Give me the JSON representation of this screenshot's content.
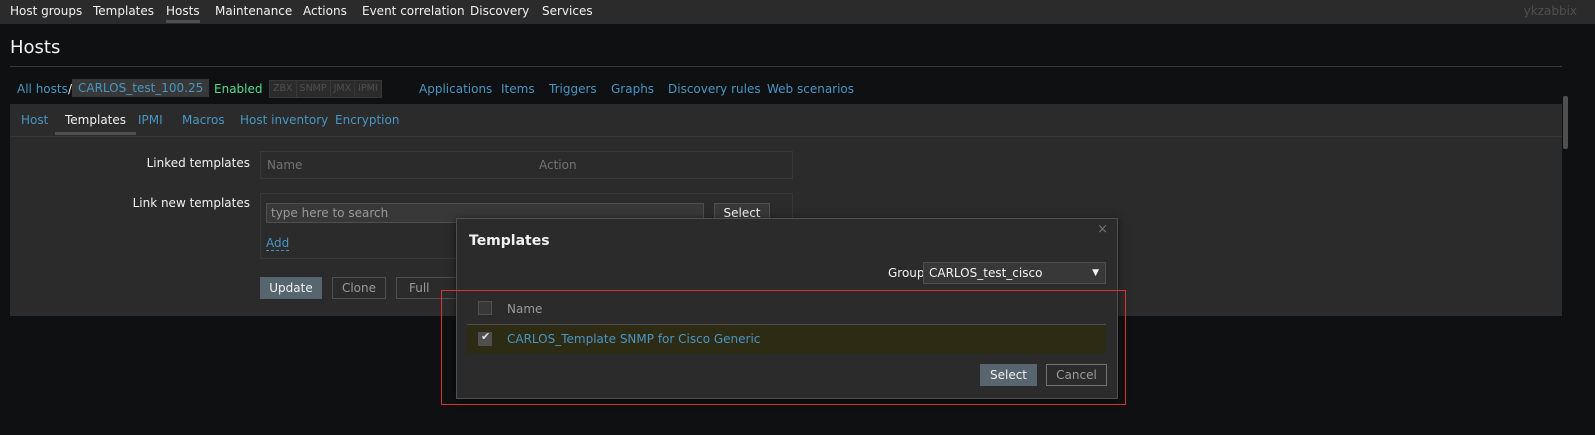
{
  "topnav": {
    "items": [
      "Host groups",
      "Templates",
      "Hosts",
      "Maintenance",
      "Actions",
      "Event correlation",
      "Discovery",
      "Services"
    ],
    "active": "Hosts",
    "user": "ykzabbix"
  },
  "page": {
    "title": "Hosts"
  },
  "host_nav": {
    "all_hosts": "All hosts",
    "separator": "/",
    "host_name": "CARLOS_test_100.25",
    "status": "Enabled",
    "availability": [
      "ZBX",
      "SNMP",
      "JMX",
      "IPMI"
    ],
    "links": [
      "Applications",
      "Items",
      "Triggers",
      "Graphs",
      "Discovery rules",
      "Web scenarios"
    ]
  },
  "tabs": [
    "Host",
    "Templates",
    "IPMI",
    "Macros",
    "Host inventory",
    "Encryption"
  ],
  "form": {
    "linked_templates_label": "Linked templates",
    "linked_columns": [
      "Name",
      "Action"
    ],
    "link_new_label": "Link new templates",
    "search_placeholder": "type here to search",
    "select_label": "Select",
    "add_label": "Add",
    "buttons": {
      "update": "Update",
      "clone": "Clone",
      "full_clone": "Full clone"
    }
  },
  "dialog": {
    "title": "Templates",
    "close_glyph": "×",
    "group_label": "Group",
    "group_value": "CARLOS_test_cisco",
    "group_arrow": "▼",
    "name_header": "Name",
    "rows": [
      {
        "name": "CARLOS_Template SNMP for Cisco Generic",
        "checked": true
      }
    ],
    "check_glyph": "✔",
    "select_label": "Select",
    "cancel_label": "Cancel"
  },
  "colors": {
    "link": "#4796c4",
    "enabled": "#59db8f",
    "highlight": "#d9322f",
    "selected_row": "#2e2b14",
    "primary_button": "#56656e"
  }
}
